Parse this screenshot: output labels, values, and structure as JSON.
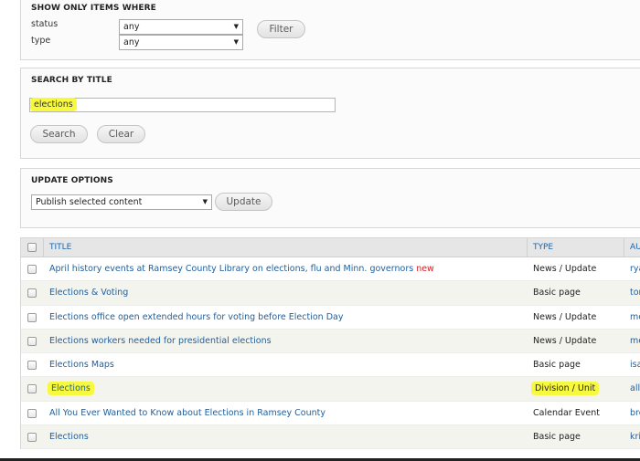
{
  "filter_panel": {
    "title": "SHOW ONLY ITEMS WHERE",
    "status_label": "status",
    "status_value": "any",
    "type_label": "type",
    "type_value": "any",
    "filter_button": "Filter"
  },
  "search_panel": {
    "title": "SEARCH BY TITLE",
    "search_value": "elections",
    "search_button": "Search",
    "clear_button": "Clear"
  },
  "update_panel": {
    "title": "UPDATE OPTIONS",
    "action_value": "Publish selected content",
    "update_button": "Update"
  },
  "table": {
    "headers": {
      "title": "TITLE",
      "type": "TYPE",
      "author": "AU"
    },
    "rows": [
      {
        "title": "April history events at Ramsey County Library on elections, flu and Minn. governors",
        "badge": "new",
        "type": "News / Update",
        "author": "rya"
      },
      {
        "title": "Elections & Voting",
        "type": "Basic page",
        "author": "tor"
      },
      {
        "title": "Elections office open extended hours for voting before Election Day",
        "type": "News / Update",
        "author": "me"
      },
      {
        "title": "Elections workers needed for presidential elections",
        "type": "News / Update",
        "author": "me"
      },
      {
        "title": "Elections Maps",
        "type": "Basic page",
        "author": "isa"
      },
      {
        "title": "Elections",
        "type": "Division / Unit",
        "author": "alli"
      },
      {
        "title": "All You Ever Wanted to Know about Elections in Ramsey County",
        "type": "Calendar Event",
        "author": "bro"
      },
      {
        "title": "Elections",
        "type": "Basic page",
        "author": "kri"
      }
    ]
  },
  "colors": {
    "link": "#1f5e9c",
    "highlight": "#f6f93d",
    "new_badge": "#e0181b"
  }
}
